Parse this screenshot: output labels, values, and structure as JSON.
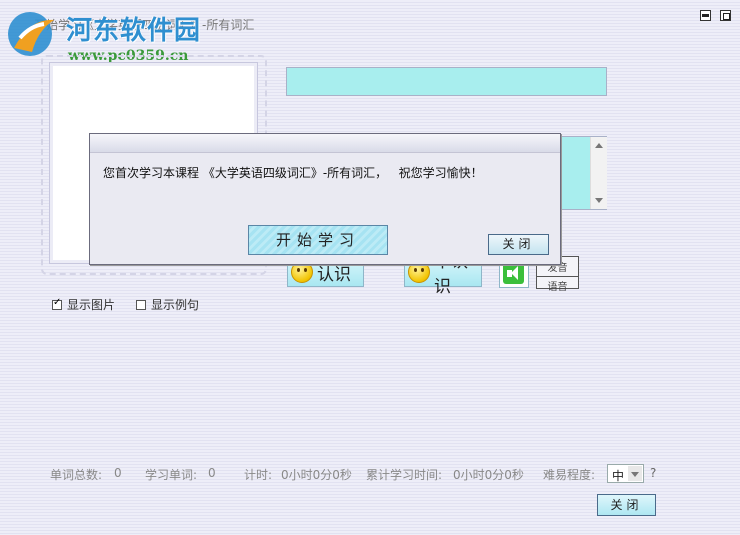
{
  "window": {
    "title": "开始学习《大学英语四级词汇》-所有词汇",
    "minimize_icon": "minimize-icon",
    "maximize_icon": "maximize-icon"
  },
  "watermark": {
    "cn": "河东软件园",
    "url": "www.pc0359.cn"
  },
  "study": {
    "know_label": "认识",
    "dontknow_label": "不认识",
    "voice_top": "发音",
    "voice_bottom": "语音",
    "show_picture_label": "显示图片",
    "show_picture_checked": true,
    "show_example_label": "显示例句",
    "show_example_checked": false
  },
  "status": {
    "total_words_label": "单词总数:",
    "total_words": "0",
    "studied_words_label": "学习单词:",
    "studied_words": "0",
    "timer_label": "计时:",
    "timer": "0小时0分0秒",
    "cumulative_label": "累计学习时间:",
    "cumulative": "0小时0分0秒",
    "difficulty_label": "难易程度:",
    "difficulty_value": "中",
    "help": "?"
  },
  "footer": {
    "close_label": "关闭"
  },
  "dialog": {
    "message": "您首次学习本课程 《大学英语四级词汇》-所有词汇，   祝您学习愉快！",
    "start_label": "开始学习",
    "close_label": "关闭"
  },
  "colors": {
    "accent_cyan": "#a8eeee",
    "background": "#eeeef8"
  }
}
